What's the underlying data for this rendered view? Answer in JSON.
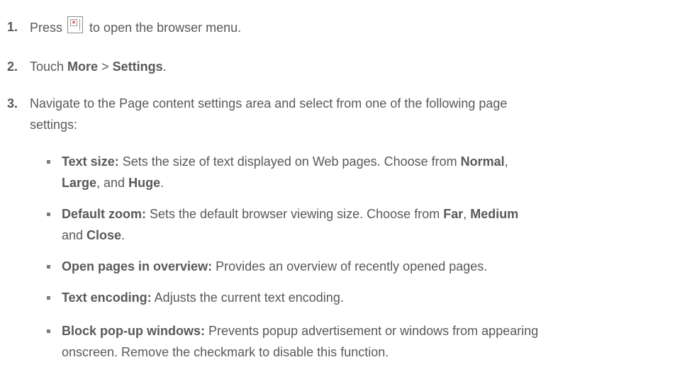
{
  "steps": [
    {
      "number": "1.",
      "before": "Press",
      "icon": "menu-key-icon",
      "after": "to open the browser menu."
    },
    {
      "number": "2.",
      "text_1": "Touch ",
      "bold_1": "More",
      "text_2": " > ",
      "bold_2": "Settings",
      "text_3": "."
    },
    {
      "number": "3.",
      "line_1": "Navigate to the Page content settings area and select from one of the following page",
      "line_2": "settings:"
    }
  ],
  "settings": [
    {
      "term": "Text size:",
      "desc_1": " Sets the size of text displayed on Web pages. Choose from ",
      "opt_1": "Normal",
      "sep_1": ",",
      "opt_2": "Large",
      "sep_2": ", and ",
      "opt_3": "Huge",
      "end": "."
    },
    {
      "term": "Default zoom:",
      "desc_1": " Sets the default browser viewing size. Choose from ",
      "opt_1": "Far",
      "sep_1": ", ",
      "opt_2": "Medium",
      "sep_2": "and ",
      "opt_3": "Close",
      "end": "."
    },
    {
      "term": "Open pages in overview:",
      "desc_1": " Provides an overview of recently opened pages."
    },
    {
      "term": "Text encoding:",
      "desc_1": " Adjusts the current text encoding."
    },
    {
      "term": "Block pop-up windows:",
      "desc_1": " Prevents popup advertisement or windows from appearing",
      "desc_2": "onscreen. Remove the checkmark to disable this function."
    }
  ]
}
